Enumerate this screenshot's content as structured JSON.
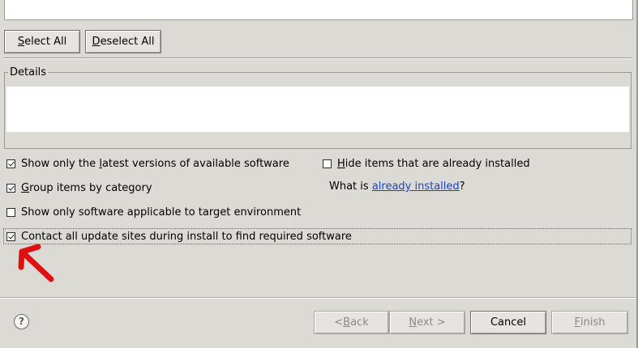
{
  "list_buttons": {
    "select_all": {
      "mnemonic": "S",
      "rest": "elect All"
    },
    "deselect_all": {
      "mnemonic": "D",
      "rest": "eselect All"
    }
  },
  "details": {
    "label": "Details"
  },
  "options": {
    "latest_versions": {
      "pre": "Show only the ",
      "mnemonic": "l",
      "post": "atest versions of available software",
      "checked": true
    },
    "group_by_category": {
      "pre": "",
      "mnemonic": "G",
      "post": "roup items by category",
      "checked": true
    },
    "target_env": {
      "label": "Show only software applicable to target environment",
      "checked": false
    },
    "contact_sites": {
      "label": "Contact all update sites during install to find required software",
      "checked": true
    },
    "hide_installed": {
      "pre": "",
      "mnemonic": "H",
      "post": "ide items that are already installed",
      "checked": false
    },
    "what_is": {
      "pre": "What is ",
      "link": "already installed",
      "post": "?"
    }
  },
  "annotation": {
    "color": "#e01010",
    "icon": "red-arrow-icon"
  },
  "footer": {
    "help_glyph": "?",
    "back": {
      "pre": "< ",
      "mnemonic": "B",
      "post": "ack"
    },
    "next": {
      "mnemonic": "N",
      "post": "ext >"
    },
    "cancel": "Cancel",
    "finish": {
      "mnemonic": "F",
      "post": "inish"
    }
  }
}
